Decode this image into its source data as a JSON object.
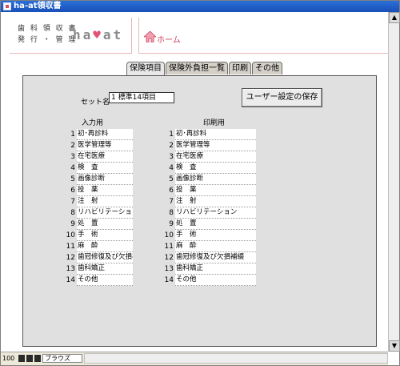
{
  "window": {
    "title": "ha-at領収書"
  },
  "header": {
    "logo_line1": "歯 科 領 収 書",
    "logo_line2": "発 行 ・ 管 理",
    "logo_mark_a": "ha",
    "logo_mark_heart": "♥",
    "logo_mark_b": "at",
    "home_label": "ホーム"
  },
  "tabs": [
    {
      "label": "保険項目",
      "active": true
    },
    {
      "label": "保険外負担一覧",
      "active": false
    },
    {
      "label": "印刷",
      "active": false
    },
    {
      "label": "その他",
      "active": false
    }
  ],
  "form": {
    "set_name_label": "セット名",
    "set_name_value": "1 標準14項目",
    "save_button": "ユーザー設定の保存",
    "input_col_header": "入力用",
    "print_col_header": "印刷用"
  },
  "input_items": [
    {
      "num": "1",
      "label": "初･再診料"
    },
    {
      "num": "2",
      "label": "医学管理等"
    },
    {
      "num": "3",
      "label": "在宅医療"
    },
    {
      "num": "4",
      "label": "検　査"
    },
    {
      "num": "5",
      "label": "画像診断"
    },
    {
      "num": "6",
      "label": "投　薬"
    },
    {
      "num": "7",
      "label": "注　射"
    },
    {
      "num": "8",
      "label": "リハビリテーション"
    },
    {
      "num": "9",
      "label": "処　置"
    },
    {
      "num": "10",
      "label": "手　術"
    },
    {
      "num": "11",
      "label": "麻　酔"
    },
    {
      "num": "12",
      "label": "歯冠修復及び欠損補綴"
    },
    {
      "num": "13",
      "label": "歯科矯正"
    },
    {
      "num": "14",
      "label": "その他"
    }
  ],
  "print_items": [
    {
      "num": "1",
      "label": "初･再診料"
    },
    {
      "num": "2",
      "label": "医学管理等"
    },
    {
      "num": "3",
      "label": "在宅医療"
    },
    {
      "num": "4",
      "label": "検　査"
    },
    {
      "num": "5",
      "label": "画像診断"
    },
    {
      "num": "6",
      "label": "投　薬"
    },
    {
      "num": "7",
      "label": "注　射"
    },
    {
      "num": "8",
      "label": "リハビリテーション"
    },
    {
      "num": "9",
      "label": "処　置"
    },
    {
      "num": "10",
      "label": "手　術"
    },
    {
      "num": "11",
      "label": "麻　酔"
    },
    {
      "num": "12",
      "label": "歯冠修復及び欠損補綴"
    },
    {
      "num": "13",
      "label": "歯科矯正"
    },
    {
      "num": "14",
      "label": "その他"
    }
  ],
  "statusbar": {
    "zoom": "100",
    "mode": "ブラウズ"
  },
  "colors": {
    "titlebar": "#1c5cc8",
    "panel": "#e0e0e0",
    "accent": "#d0425c"
  }
}
